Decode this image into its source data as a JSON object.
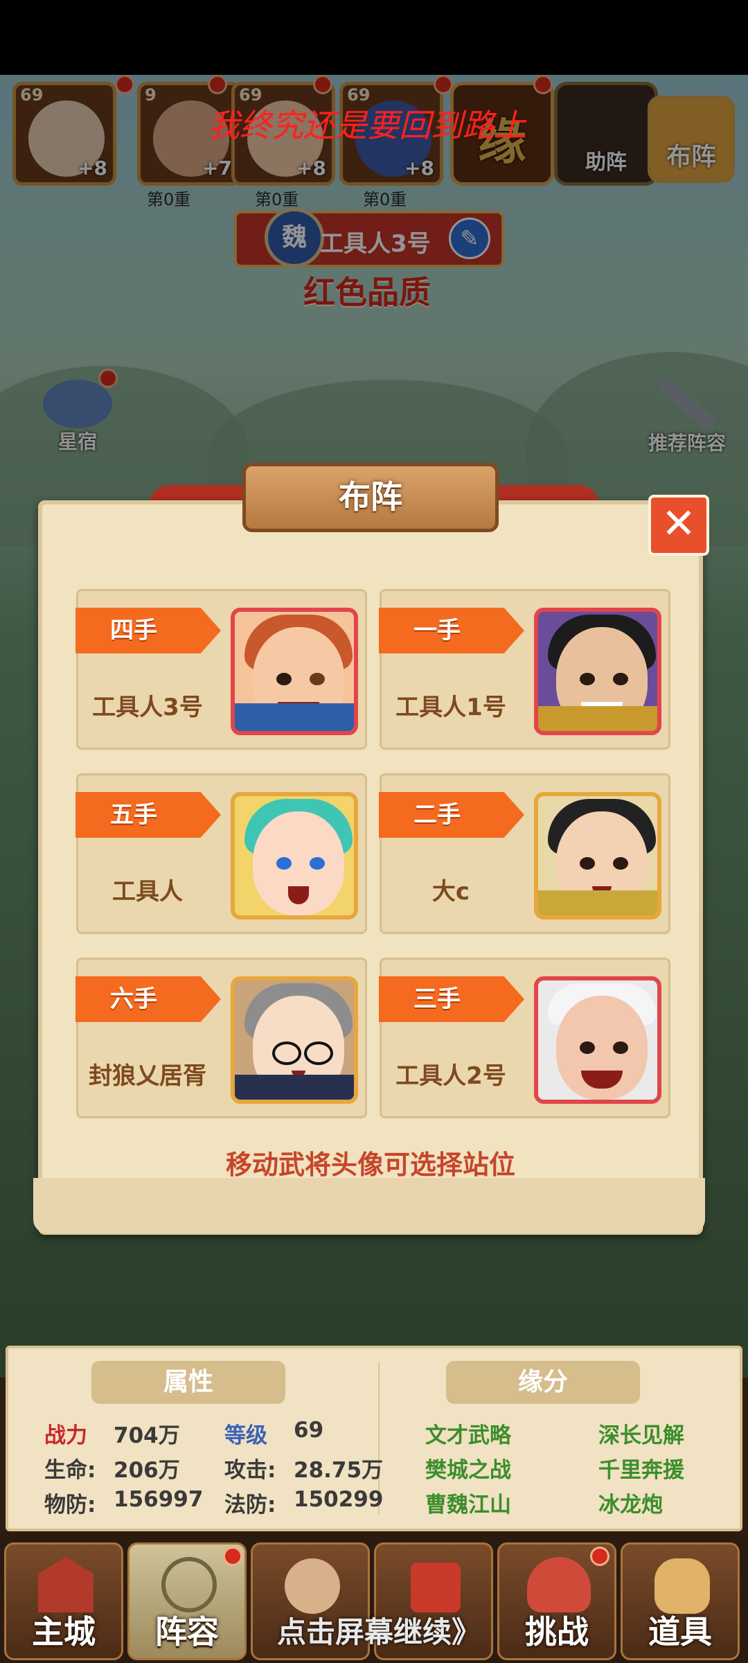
{
  "overlay_banner": "我终究还是要回到路上",
  "top_heroes": [
    {
      "level": "69",
      "plus": "+8",
      "tier": ""
    },
    {
      "level": "9",
      "plus": "+7",
      "tier": "第0重"
    },
    {
      "level": "69",
      "plus": "+8",
      "tier": "第0重"
    },
    {
      "level": "69",
      "plus": "+8",
      "tier": "第0重"
    }
  ],
  "top_buttons": {
    "fate": "缘",
    "assist": "助阵",
    "formation": "布阵"
  },
  "character": {
    "kingdom": "魏",
    "name": "工具人3号",
    "quality": "红色品质"
  },
  "side_buttons": {
    "star": "星宿",
    "recommend": "推荐阵容"
  },
  "dialog": {
    "title": "布阵",
    "slots": [
      {
        "position": "四手",
        "name": "工具人3号"
      },
      {
        "position": "一手",
        "name": "工具人1号"
      },
      {
        "position": "五手",
        "name": "工具人"
      },
      {
        "position": "二手",
        "name": "大c"
      },
      {
        "position": "六手",
        "name": "封狼乂居胥"
      },
      {
        "position": "三手",
        "name": "工具人2号"
      }
    ],
    "hint": "移动武将头像可选择站位"
  },
  "attributes": {
    "header": "属性",
    "power_label": "战力",
    "power": "704万",
    "level_label": "等级",
    "level": "69",
    "hp_label": "生命:",
    "hp": "206万",
    "atk_label": "攻击:",
    "atk": "28.75万",
    "pdef_label": "物防:",
    "pdef": "156997",
    "mdef_label": "法防:",
    "mdef": "150299"
  },
  "fate": {
    "header": "缘分",
    "items": [
      "文才武略",
      "深长见解",
      "樊城之战",
      "千里奔援",
      "曹魏江山",
      "冰龙炮"
    ]
  },
  "nav": {
    "main_city": "主城",
    "lineup": "阵容",
    "challenge": "挑战",
    "items": "道具"
  },
  "continue_text": "点击屏幕继续》",
  "colors": {
    "accent_orange": "#f46a1f",
    "hint_red": "#c6452a",
    "fate_green": "#3c8d2c",
    "power_red": "#c8282a",
    "level_blue": "#3a62b8"
  }
}
